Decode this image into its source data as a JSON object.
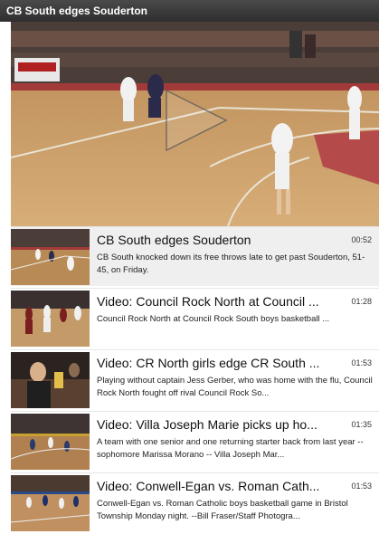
{
  "widget": {
    "title": "CB South edges Souderton"
  },
  "player": {
    "play_icon": "play-icon"
  },
  "playlist": {
    "items": [
      {
        "title": "CB South edges Souderton",
        "duration": "00:52",
        "description": "CB South knocked down its free throws late to get past Souderton, 51-45, on Friday."
      },
      {
        "title": "Video: Council Rock North at Council ...",
        "duration": "01:28",
        "description": "Council Rock North at Council Rock South boys basketball ..."
      },
      {
        "title": "Video: CR North girls edge CR South ...",
        "duration": "01:53",
        "description": "Playing without captain Jess Gerber, who was home with the flu, Council Rock North fought off rival Council Rock So..."
      },
      {
        "title": "Video: Villa Joseph Marie picks up ho...",
        "duration": "01:35",
        "description": "A team with one senior and one returning starter back from last year -- sophomore Marissa Morano -- Villa Joseph Mar..."
      },
      {
        "title": "Video: Conwell-Egan vs. Roman Cath...",
        "duration": "01:53",
        "description": "Conwell-Egan vs. Roman Catholic boys basketball game in Bristol Township Monday night. --Bill Fraser/Staff Photogra..."
      }
    ]
  }
}
